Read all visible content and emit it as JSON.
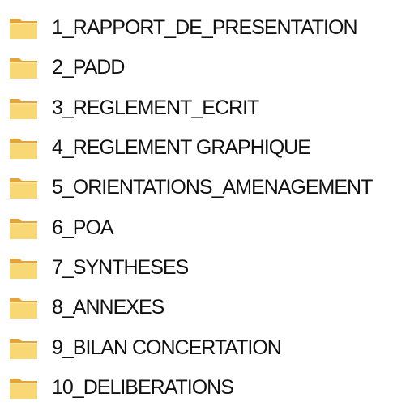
{
  "folders": [
    {
      "name": "1_RAPPORT_DE_PRESENTATION",
      "icon": "folder-icon"
    },
    {
      "name": "2_PADD",
      "icon": "folder-icon"
    },
    {
      "name": "3_REGLEMENT_ECRIT",
      "icon": "folder-icon"
    },
    {
      "name": "4_REGLEMENT GRAPHIQUE",
      "icon": "folder-icon"
    },
    {
      "name": "5_ORIENTATIONS_AMENAGEMENT",
      "icon": "folder-icon"
    },
    {
      "name": "6_POA",
      "icon": "folder-icon"
    },
    {
      "name": "7_SYNTHESES",
      "icon": "folder-icon"
    },
    {
      "name": "8_ANNEXES",
      "icon": "folder-icon"
    },
    {
      "name": "9_BILAN CONCERTATION",
      "icon": "folder-icon"
    },
    {
      "name": "10_DELIBERATIONS",
      "icon": "folder-icon"
    }
  ],
  "colors": {
    "folder_back": "#e2a53b",
    "folder_front": "#f8d775",
    "folder_edge": "#c98f2a",
    "text": "#111111"
  }
}
